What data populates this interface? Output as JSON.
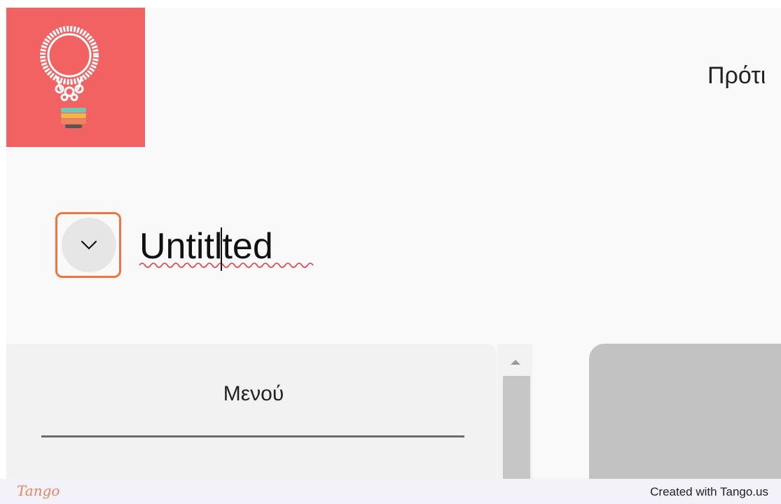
{
  "brand": {
    "background_color": "#f26262",
    "icon": "lightbulb-gear-icon"
  },
  "header": {
    "nav_text": "Πρότι"
  },
  "document": {
    "title": "Untitlted",
    "expand_icon": "chevron-down-icon"
  },
  "highlight_color": "#f2743f",
  "menu": {
    "label": "Μενού"
  },
  "scrollbar": {
    "up_icon": "arrow-up-icon"
  },
  "footer": {
    "logo_text": "Tango",
    "credit": "Created with Tango.us"
  }
}
